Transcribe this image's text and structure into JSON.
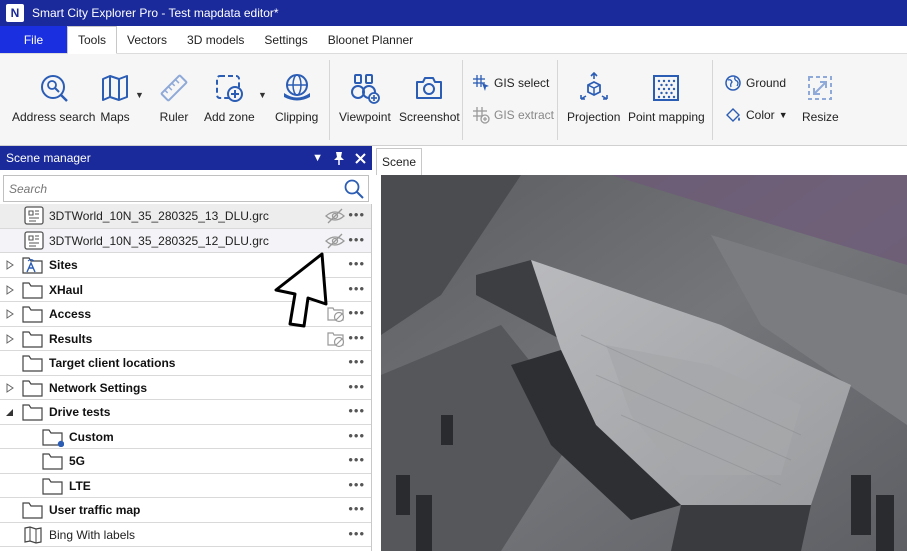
{
  "window": {
    "title": "Smart City Explorer Pro - Test mapdata editor*",
    "logo_text": "N"
  },
  "menu": {
    "file": "File",
    "items": [
      "Tools",
      "Vectors",
      "3D models",
      "Settings",
      "Bloonet Planner"
    ],
    "active": "Tools"
  },
  "ribbon": {
    "address_search": "Address search",
    "maps": "Maps",
    "ruler": "Ruler",
    "add_zone": "Add zone",
    "clipping": "Clipping",
    "viewpoint": "Viewpoint",
    "screenshot": "Screenshot",
    "gis_select": "GIS select",
    "gis_extract": "GIS extract",
    "projection": "Projection",
    "point_mapping": "Point mapping",
    "ground": "Ground",
    "color": "Color",
    "resize": "Resize"
  },
  "scene_manager": {
    "title": "Scene manager",
    "search_placeholder": "Search",
    "rows": [
      {
        "label": "3DTWorld_10N_35_280325_13_DLU.grc"
      },
      {
        "label": "3DTWorld_10N_35_280325_12_DLU.grc"
      },
      {
        "label": "Sites"
      },
      {
        "label": "XHaul"
      },
      {
        "label": "Access"
      },
      {
        "label": "Results"
      },
      {
        "label": "Target client locations"
      },
      {
        "label": "Network Settings"
      },
      {
        "label": "Drive tests"
      },
      {
        "label": "Custom"
      },
      {
        "label": "5G"
      },
      {
        "label": "LTE"
      },
      {
        "label": "User traffic map"
      },
      {
        "label": "Bing With labels"
      }
    ],
    "more_glyph": "•••"
  },
  "scene": {
    "tab_label": "Scene"
  },
  "colors": {
    "title_bar": "#1a2a9a",
    "file_menu": "#1a2fe0",
    "accent_icon": "#2b5db5"
  }
}
